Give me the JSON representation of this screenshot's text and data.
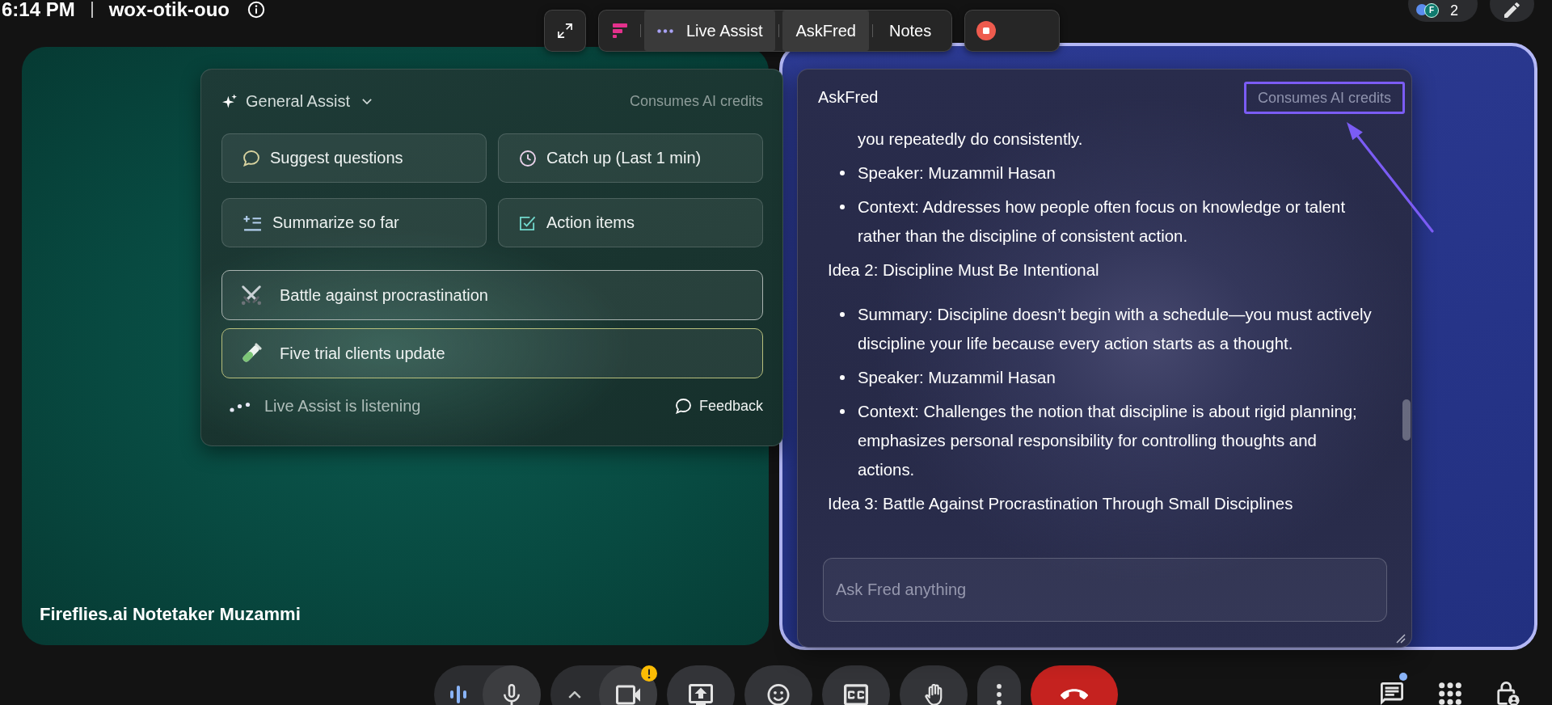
{
  "top_bar": {
    "time": "6:14 PM",
    "meeting_code": "wox-otik-ouo",
    "avatar_initial": "F",
    "participant_count": "2"
  },
  "companion_toolbar": {
    "tabs": [
      {
        "label": "Live Assist",
        "kind": "live",
        "selected": true
      },
      {
        "label": "AskFred",
        "kind": "plain",
        "selected": true
      },
      {
        "label": "Notes",
        "kind": "plain",
        "selected": false
      }
    ]
  },
  "tiles": [
    {
      "name": "Fireflies.ai Notetaker Muzammi",
      "speaking": false
    },
    {
      "speaking": true
    }
  ],
  "live_assist": {
    "mode": "General Assist",
    "credits_note": "Consumes AI credits",
    "actions": [
      {
        "label": "Suggest questions"
      },
      {
        "label": "Catch up (Last 1 min)"
      },
      {
        "label": "Summarize so far"
      },
      {
        "label": "Action items"
      }
    ],
    "topics": [
      {
        "label": "Battle against procrastination",
        "color": "#a9b3b0"
      },
      {
        "label": "Five trial clients update",
        "color": "#b7bf7c"
      }
    ],
    "status": "Live Assist is listening",
    "feedback": "Feedback"
  },
  "ask_fred": {
    "title": "AskFred",
    "credits_note": {
      "text": "Consumes AI credits",
      "highlighted": true
    },
    "messages": [
      {
        "kind": "continuation",
        "text": "you repeatedly do consistently."
      },
      {
        "kind": "bullet",
        "text": "Speaker: Muzammil Hasan"
      },
      {
        "kind": "bullet",
        "text": "Context: Addresses how people often focus on knowledge or talent rather than the discipline of consistent action."
      },
      {
        "kind": "heading",
        "text": "Idea 2: Discipline Must Be Intentional"
      },
      {
        "kind": "bullet",
        "text": "Summary: Discipline doesn’t begin with a schedule—you must actively discipline your life because every action starts as a thought."
      },
      {
        "kind": "bullet",
        "text": "Speaker: Muzammil Hasan"
      },
      {
        "kind": "bullet",
        "text": "Context: Challenges the notion that discipline is about rigid planning; emphasizes personal responsibility for controlling thoughts and actions."
      },
      {
        "kind": "heading",
        "text": "Idea 3: Battle Against Procrastination Through Small Disciplines"
      }
    ],
    "input": {
      "placeholder": "Ask Fred anything"
    }
  },
  "call_controls": {
    "camera_warning": true,
    "chat_unread": true
  }
}
